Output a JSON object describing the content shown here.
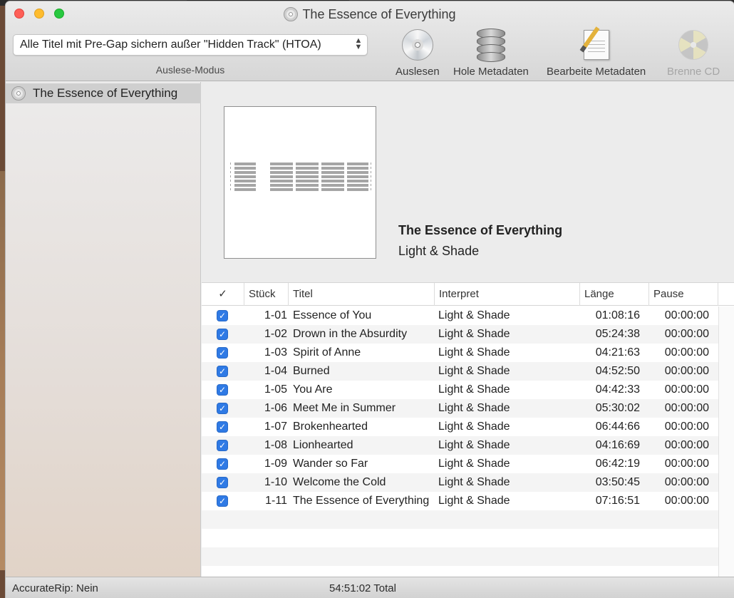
{
  "window": {
    "title": "The Essence of Everything"
  },
  "toolbar": {
    "mode_select_value": "Alle Titel mit Pre-Gap sichern außer \"Hidden Track\" (HTOA)",
    "mode_label": "Auslese-Modus",
    "buttons": [
      {
        "label": "Auslesen",
        "icon": "cd-icon",
        "enabled": true
      },
      {
        "label": "Hole Metadaten",
        "icon": "database-icon",
        "enabled": true
      },
      {
        "label": "Bearbeite Metadaten",
        "icon": "edit-document-icon",
        "enabled": true
      },
      {
        "label": "Brenne CD",
        "icon": "burn-cd-icon",
        "enabled": false
      }
    ]
  },
  "sidebar": {
    "items": [
      {
        "label": "The Essence of Everything",
        "icon": "cd-icon",
        "selected": true
      }
    ]
  },
  "album": {
    "title": "The Essence of Everything",
    "artist": "Light & Shade"
  },
  "table": {
    "columns": {
      "check": "✓",
      "track": "Stück",
      "title": "Titel",
      "artist": "Interpret",
      "length": "Länge",
      "pause": "Pause"
    },
    "rows": [
      {
        "checked": true,
        "track": "1-01",
        "title": "Essence of You",
        "artist": "Light & Shade",
        "length": "01:08:16",
        "pause": "00:00:00"
      },
      {
        "checked": true,
        "track": "1-02",
        "title": "Drown in the Absurdity",
        "artist": "Light & Shade",
        "length": "05:24:38",
        "pause": "00:00:00"
      },
      {
        "checked": true,
        "track": "1-03",
        "title": "Spirit of Anne",
        "artist": "Light & Shade",
        "length": "04:21:63",
        "pause": "00:00:00"
      },
      {
        "checked": true,
        "track": "1-04",
        "title": "Burned",
        "artist": "Light & Shade",
        "length": "04:52:50",
        "pause": "00:00:00"
      },
      {
        "checked": true,
        "track": "1-05",
        "title": "You Are",
        "artist": "Light & Shade",
        "length": "04:42:33",
        "pause": "00:00:00"
      },
      {
        "checked": true,
        "track": "1-06",
        "title": "Meet Me in Summer",
        "artist": "Light & Shade",
        "length": "05:30:02",
        "pause": "00:00:00"
      },
      {
        "checked": true,
        "track": "1-07",
        "title": "Brokenhearted",
        "artist": "Light & Shade",
        "length": "06:44:66",
        "pause": "00:00:00"
      },
      {
        "checked": true,
        "track": "1-08",
        "title": "Lionhearted",
        "artist": "Light & Shade",
        "length": "04:16:69",
        "pause": "00:00:00"
      },
      {
        "checked": true,
        "track": "1-09",
        "title": "Wander so Far",
        "artist": "Light & Shade",
        "length": "06:42:19",
        "pause": "00:00:00"
      },
      {
        "checked": true,
        "track": "1-10",
        "title": "Welcome the Cold",
        "artist": "Light & Shade",
        "length": "03:50:45",
        "pause": "00:00:00"
      },
      {
        "checked": true,
        "track": "1-11",
        "title": "The Essence of Everything",
        "artist": "Light & Shade",
        "length": "07:16:51",
        "pause": "00:00:00"
      }
    ]
  },
  "status": {
    "accuraterip": "AccurateRip: Nein",
    "total": "54:51:02 Total"
  },
  "colors": {
    "checkbox": "#2f7ae5",
    "selected_sidebar": "#cfcfcf",
    "close": "#fe5f57",
    "minimize": "#febc2e",
    "maximize": "#28c840"
  }
}
